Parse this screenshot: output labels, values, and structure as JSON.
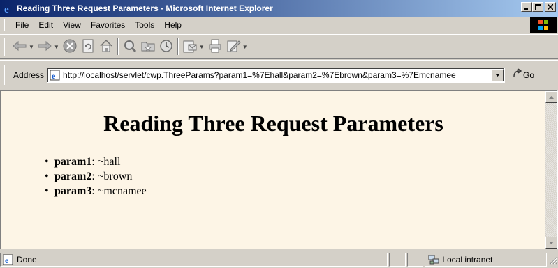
{
  "window": {
    "title": "Reading Three Request Parameters - Microsoft Internet Explorer",
    "buttons": {
      "minimize": "_",
      "maximize": "□",
      "close": "×"
    }
  },
  "menu": {
    "items": [
      {
        "label": "File",
        "accel": "F",
        "rest": "ile"
      },
      {
        "label": "Edit",
        "accel": "E",
        "rest": "dit"
      },
      {
        "label": "View",
        "accel": "V",
        "rest": "iew"
      },
      {
        "label": "Favorites",
        "pre": "F",
        "accel": "a",
        "rest": "vorites"
      },
      {
        "label": "Tools",
        "accel": "T",
        "rest": "ools"
      },
      {
        "label": "Help",
        "accel": "H",
        "rest": "elp"
      }
    ]
  },
  "toolbar": {
    "icons": [
      "back-icon",
      "forward-icon",
      "stop-icon",
      "refresh-icon",
      "home-icon",
      "search-icon",
      "favorites-icon",
      "history-icon",
      "mail-icon",
      "print-icon",
      "edit-icon"
    ]
  },
  "address": {
    "label_pre": "A",
    "label_accel": "d",
    "label_rest": "dress",
    "url": "http://localhost/servlet/cwp.ThreeParams?param1=%7Ehall&param2=%7Ebrown&param3=%7Emcnamee",
    "go_label": "Go"
  },
  "page": {
    "heading": "Reading Three Request Parameters",
    "params": [
      {
        "name": "param1",
        "value": ": ~hall"
      },
      {
        "name": "param2",
        "value": ": ~brown"
      },
      {
        "name": "param3",
        "value": ": ~mcnamee"
      }
    ],
    "background": "#fdf5e6"
  },
  "status": {
    "text": "Done",
    "zone": "Local intranet"
  },
  "colors": {
    "titlebar_start": "#0a246a",
    "titlebar_end": "#a6caf0",
    "chrome": "#d4d0c8"
  }
}
